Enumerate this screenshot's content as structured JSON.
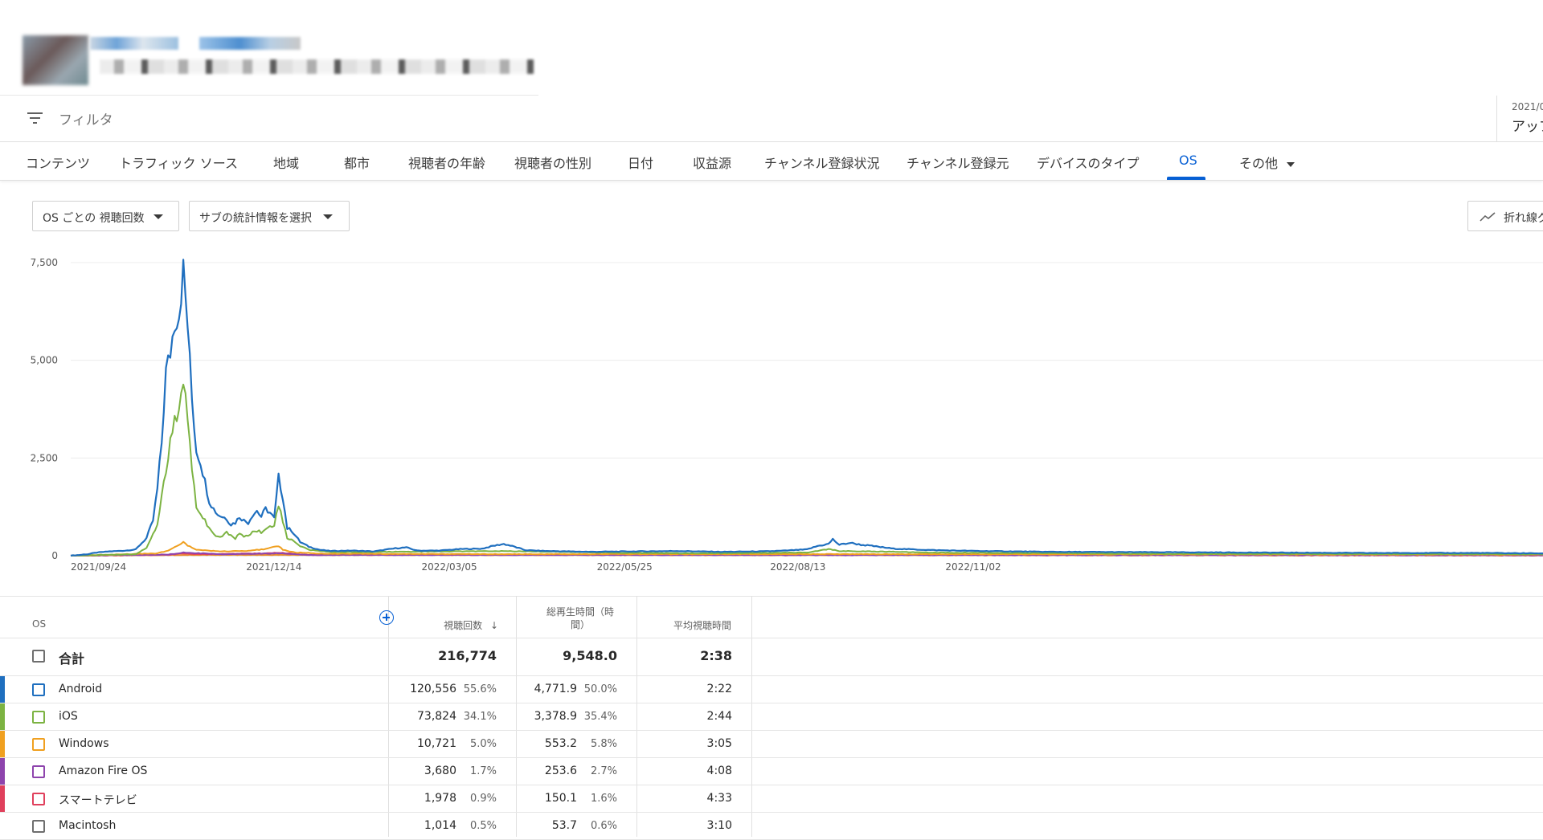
{
  "filter": {
    "label": "フィルタ"
  },
  "date_range": {
    "small": "2021/0",
    "big": "アップ"
  },
  "tabs": [
    {
      "label": "コンテンツ"
    },
    {
      "label": "トラフィック ソース"
    },
    {
      "label": "地域"
    },
    {
      "label": "都市"
    },
    {
      "label": "視聴者の年齢"
    },
    {
      "label": "視聴者の性別"
    },
    {
      "label": "日付"
    },
    {
      "label": "収益源"
    },
    {
      "label": "チャンネル登録状況"
    },
    {
      "label": "チャンネル登録元"
    },
    {
      "label": "デバイスのタイプ"
    },
    {
      "label": "OS"
    },
    {
      "label": "その他"
    }
  ],
  "active_tab": "OS",
  "controls": {
    "metric_select": "OS ごとの 視聴回数",
    "sub_metric_select": "サブの統計情報を選択",
    "chart_type": "折れ線グ"
  },
  "chart_data": {
    "type": "line",
    "x_ticks": [
      "2021/09/24",
      "2021/12/14",
      "2022/03/05",
      "2022/05/25",
      "2022/08/13",
      "2022/11/02"
    ],
    "y_ticks": [
      "7,500",
      "5,000",
      "2,500",
      "0"
    ],
    "ylim": [
      0,
      7500
    ],
    "grid": true,
    "series": [
      {
        "name": "Android",
        "color": "#1f6fbf",
        "peaks": [
          [
            0,
            0
          ],
          [
            8,
            40
          ],
          [
            12,
            80
          ],
          [
            18,
            110
          ],
          [
            25,
            130
          ],
          [
            30,
            160
          ],
          [
            35,
            450
          ],
          [
            38,
            900
          ],
          [
            40,
            1700
          ],
          [
            42,
            2900
          ],
          [
            43,
            3800
          ],
          [
            44,
            4700
          ],
          [
            46,
            5200
          ],
          [
            48,
            6000
          ],
          [
            50,
            6200
          ],
          [
            52,
            7300
          ],
          [
            54,
            5900
          ],
          [
            56,
            4000
          ],
          [
            58,
            2700
          ],
          [
            60,
            2400
          ],
          [
            62,
            1900
          ],
          [
            64,
            1400
          ],
          [
            66,
            1200
          ],
          [
            68,
            1050
          ],
          [
            70,
            1000
          ],
          [
            72,
            950
          ],
          [
            74,
            800
          ],
          [
            76,
            850
          ],
          [
            78,
            1000
          ],
          [
            80,
            900
          ],
          [
            82,
            850
          ],
          [
            84,
            1050
          ],
          [
            86,
            1150
          ],
          [
            88,
            1000
          ],
          [
            90,
            1200
          ],
          [
            92,
            1100
          ],
          [
            94,
            950
          ],
          [
            96,
            2000
          ],
          [
            98,
            1500
          ],
          [
            100,
            700
          ],
          [
            102,
            650
          ],
          [
            104,
            500
          ],
          [
            106,
            350
          ],
          [
            110,
            230
          ],
          [
            115,
            150
          ],
          [
            120,
            120
          ],
          [
            130,
            130
          ],
          [
            140,
            110
          ],
          [
            150,
            190
          ],
          [
            155,
            210
          ],
          [
            160,
            130
          ],
          [
            170,
            130
          ],
          [
            180,
            170
          ],
          [
            190,
            180
          ],
          [
            195,
            250
          ],
          [
            200,
            300
          ],
          [
            205,
            230
          ],
          [
            210,
            140
          ],
          [
            220,
            120
          ],
          [
            240,
            100
          ],
          [
            260,
            110
          ],
          [
            280,
            120
          ],
          [
            300,
            100
          ],
          [
            320,
            110
          ],
          [
            330,
            130
          ],
          [
            340,
            160
          ],
          [
            345,
            250
          ],
          [
            350,
            300
          ],
          [
            352,
            420
          ],
          [
            355,
            280
          ],
          [
            360,
            330
          ],
          [
            365,
            280
          ],
          [
            370,
            250
          ],
          [
            380,
            180
          ],
          [
            390,
            160
          ],
          [
            400,
            140
          ],
          [
            420,
            120
          ],
          [
            450,
            100
          ],
          [
            500,
            90
          ],
          [
            550,
            80
          ],
          [
            600,
            70
          ],
          [
            650,
            70
          ],
          [
            680,
            60
          ]
        ]
      },
      {
        "name": "iOS",
        "color": "#7cb342",
        "peaks": [
          [
            0,
            0
          ],
          [
            30,
            40
          ],
          [
            35,
            200
          ],
          [
            40,
            800
          ],
          [
            42,
            1500
          ],
          [
            44,
            2200
          ],
          [
            46,
            2900
          ],
          [
            48,
            3400
          ],
          [
            50,
            3800
          ],
          [
            52,
            4600
          ],
          [
            54,
            3500
          ],
          [
            56,
            2300
          ],
          [
            58,
            1300
          ],
          [
            60,
            1100
          ],
          [
            62,
            900
          ],
          [
            64,
            700
          ],
          [
            66,
            550
          ],
          [
            68,
            500
          ],
          [
            70,
            520
          ],
          [
            72,
            600
          ],
          [
            74,
            500
          ],
          [
            76,
            450
          ],
          [
            78,
            550
          ],
          [
            80,
            500
          ],
          [
            82,
            520
          ],
          [
            84,
            600
          ],
          [
            86,
            650
          ],
          [
            88,
            600
          ],
          [
            90,
            700
          ],
          [
            92,
            800
          ],
          [
            94,
            750
          ],
          [
            96,
            1300
          ],
          [
            98,
            900
          ],
          [
            100,
            450
          ],
          [
            102,
            400
          ],
          [
            104,
            350
          ],
          [
            106,
            250
          ],
          [
            110,
            150
          ],
          [
            120,
            90
          ],
          [
            150,
            100
          ],
          [
            200,
            120
          ],
          [
            260,
            70
          ],
          [
            300,
            60
          ],
          [
            340,
            80
          ],
          [
            350,
            170
          ],
          [
            355,
            120
          ],
          [
            370,
            110
          ],
          [
            400,
            80
          ],
          [
            500,
            50
          ],
          [
            680,
            40
          ]
        ]
      },
      {
        "name": "Windows",
        "color": "#f0a020",
        "peaks": [
          [
            0,
            0
          ],
          [
            40,
            60
          ],
          [
            46,
            150
          ],
          [
            50,
            280
          ],
          [
            52,
            350
          ],
          [
            54,
            260
          ],
          [
            58,
            150
          ],
          [
            70,
            110
          ],
          [
            80,
            120
          ],
          [
            90,
            170
          ],
          [
            94,
            230
          ],
          [
            96,
            250
          ],
          [
            98,
            150
          ],
          [
            104,
            80
          ],
          [
            120,
            50
          ],
          [
            200,
            40
          ],
          [
            350,
            40
          ],
          [
            680,
            30
          ]
        ]
      },
      {
        "name": "Amazon Fire OS",
        "color": "#8e44ad",
        "peaks": [
          [
            0,
            0
          ],
          [
            45,
            30
          ],
          [
            52,
            80
          ],
          [
            56,
            70
          ],
          [
            70,
            40
          ],
          [
            96,
            60
          ],
          [
            110,
            20
          ],
          [
            680,
            10
          ]
        ]
      },
      {
        "name": "スマートテレビ",
        "color": "#e0405c",
        "peaks": [
          [
            0,
            0
          ],
          [
            44,
            20
          ],
          [
            52,
            60
          ],
          [
            60,
            40
          ],
          [
            90,
            60
          ],
          [
            96,
            80
          ],
          [
            110,
            20
          ],
          [
            350,
            30
          ],
          [
            680,
            15
          ]
        ]
      },
      {
        "name": "Macintosh",
        "color": "#e98a2a",
        "peaks": [
          [
            0,
            0
          ],
          [
            50,
            20
          ],
          [
            96,
            20
          ],
          [
            680,
            5
          ]
        ]
      }
    ]
  },
  "table": {
    "headers": {
      "os": "OS",
      "views": "視聴回数",
      "watch_time": "総再生時間（時間）",
      "avg": "平均視聴時間"
    },
    "total": {
      "name": "合計",
      "views": "216,774",
      "watch": "9,548.0",
      "avg": "2:38"
    },
    "rows": [
      {
        "name": "Android",
        "views": "120,556",
        "views_pct": "55.6%",
        "watch": "4,771.9",
        "watch_pct": "50.0%",
        "avg": "2:22",
        "color": "#1f6fbf"
      },
      {
        "name": "iOS",
        "views": "73,824",
        "views_pct": "34.1%",
        "watch": "3,378.9",
        "watch_pct": "35.4%",
        "avg": "2:44",
        "color": "#7cb342"
      },
      {
        "name": "Windows",
        "views": "10,721",
        "views_pct": "5.0%",
        "watch": "553.2",
        "watch_pct": "5.8%",
        "avg": "3:05",
        "color": "#f0a020"
      },
      {
        "name": "Amazon Fire OS",
        "views": "3,680",
        "views_pct": "1.7%",
        "watch": "253.6",
        "watch_pct": "2.7%",
        "avg": "4:08",
        "color": "#8e44ad"
      },
      {
        "name": "スマートテレビ",
        "views": "1,978",
        "views_pct": "0.9%",
        "watch": "150.1",
        "watch_pct": "1.6%",
        "avg": "4:33",
        "color": "#e0405c"
      },
      {
        "name": "Macintosh",
        "views": "1,014",
        "views_pct": "0.5%",
        "watch": "53.7",
        "watch_pct": "0.6%",
        "avg": "3:10",
        "color": ""
      }
    ]
  }
}
